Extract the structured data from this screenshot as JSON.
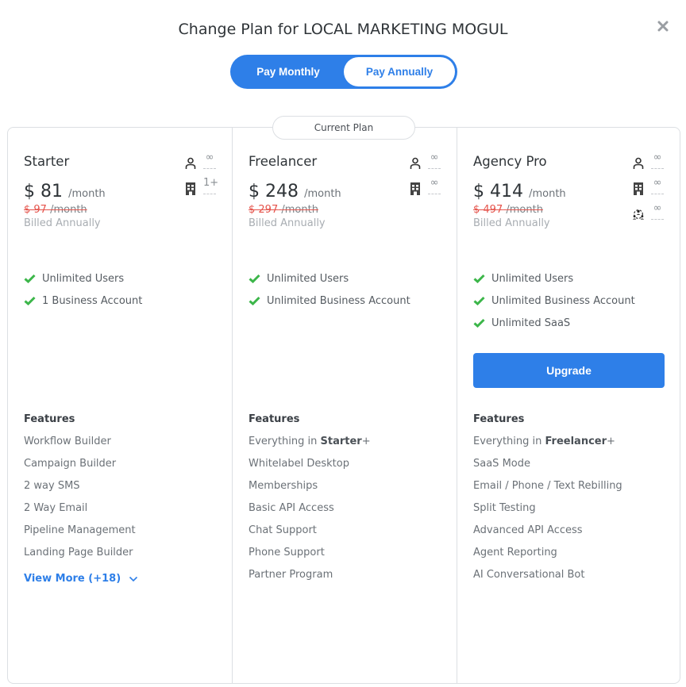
{
  "dialog": {
    "title": "Change Plan for LOCAL MARKETING MOGUL",
    "close_icon": "close-icon"
  },
  "billing_toggle": {
    "options": [
      {
        "label": "Pay Monthly",
        "selected": false
      },
      {
        "label": "Pay Annually",
        "selected": true
      }
    ]
  },
  "current_plan_badge": "Current Plan",
  "colors": {
    "accent": "#2e7fe8",
    "check": "#3cb64a",
    "old_price": "#e5534b"
  },
  "plans": [
    {
      "name": "Starter",
      "price": "$ 81",
      "period": "/month",
      "old_price": "$ 97",
      "old_period": "/month",
      "billing_note": "Billed Annually",
      "limits": [
        {
          "icon": "user-icon",
          "value": "∞"
        },
        {
          "icon": "building-icon",
          "value": "1+"
        }
      ],
      "highlights": [
        "Unlimited Users",
        "1 Business Account"
      ],
      "features_heading": "Features",
      "features": [
        "Workflow Builder",
        "Campaign Builder",
        "2 way SMS",
        "2 Way Email",
        "Pipeline Management",
        "Landing Page Builder"
      ],
      "view_more": "View More (+18)"
    },
    {
      "name": "Freelancer",
      "price": "$ 248",
      "period": "/month",
      "old_price": "$ 297",
      "old_period": "/month",
      "billing_note": "Billed Annually",
      "is_current": true,
      "limits": [
        {
          "icon": "user-icon",
          "value": "∞"
        },
        {
          "icon": "building-icon",
          "value": "∞"
        }
      ],
      "highlights": [
        "Unlimited Users",
        "Unlimited Business Account"
      ],
      "features_heading": "Features",
      "features_intro": {
        "prefix": "Everything in ",
        "bold": "Starter",
        "suffix": "+"
      },
      "features": [
        "Whitelabel Desktop",
        "Memberships",
        "Basic API Access",
        "Chat Support",
        "Phone Support",
        "Partner Program"
      ]
    },
    {
      "name": "Agency Pro",
      "price": "$ 414",
      "period": "/month",
      "old_price": "$ 497",
      "old_period": "/month",
      "billing_note": "Billed Annually",
      "limits": [
        {
          "icon": "user-icon",
          "value": "∞"
        },
        {
          "icon": "building-icon",
          "value": "∞"
        },
        {
          "icon": "team-icon",
          "value": "∞"
        }
      ],
      "highlights": [
        "Unlimited Users",
        "Unlimited Business Account",
        "Unlimited SaaS"
      ],
      "upgrade_label": "Upgrade",
      "features_heading": "Features",
      "features_intro": {
        "prefix": "Everything in ",
        "bold": "Freelancer",
        "suffix": "+"
      },
      "features": [
        "SaaS Mode",
        "Email / Phone / Text Rebilling",
        "Split Testing",
        "Advanced API Access",
        "Agent Reporting",
        "AI Conversational Bot"
      ]
    }
  ]
}
